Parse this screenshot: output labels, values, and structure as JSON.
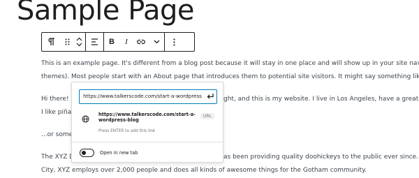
{
  "page": {
    "title": "Sample Page"
  },
  "toolbar": {
    "paragraph_icon": "paragraph-icon",
    "drag_icon": "drag-handle-icon",
    "move_icons": "move-up-down-icon",
    "align_icon": "align-left-icon",
    "bold_label": "B",
    "italic_label": "I",
    "link_icon": "link-icon",
    "more_format_icon": "chevron-down-icon",
    "options_icon": "more-vertical-icon"
  },
  "content": {
    "p1_line1": "This is an example page. It's different from a blog post because it will stay in one place and will show up in your site navi",
    "p1_line2": "themes). Most people start with an About page that introduces them to potential site visitors. It might say something lik",
    "p2_line1_a": "Hi there! ",
    "p2_line1_b": "ght, and this is my website. I live in Los Angeles, have a great d",
    "p2_line2": "I like piña",
    "p3_line1": "...or some",
    "p4_line1_a": "The XYZ D",
    "p4_line1_b": "as been providing quality doohickeys to the public ever since. l",
    "p4_line2": "City, XYZ employs over 2,000 people and does all kinds of awesome things for the Gotham community."
  },
  "link_popover": {
    "url_value": "https://www.talkerscode.com/start-a-wordpress",
    "submit_icon": "enter-icon",
    "suggestion": {
      "icon": "globe-icon",
      "title": "https://www.talkerscode.com/start-a-wordpress-blog",
      "hint": "Press ENTER to add this link",
      "badge": "URL"
    },
    "new_tab_label": "Open in new tab",
    "new_tab_enabled": false
  },
  "colors": {
    "accent": "#007cba",
    "text": "#1e1e1e",
    "body_text": "#3c434a"
  }
}
